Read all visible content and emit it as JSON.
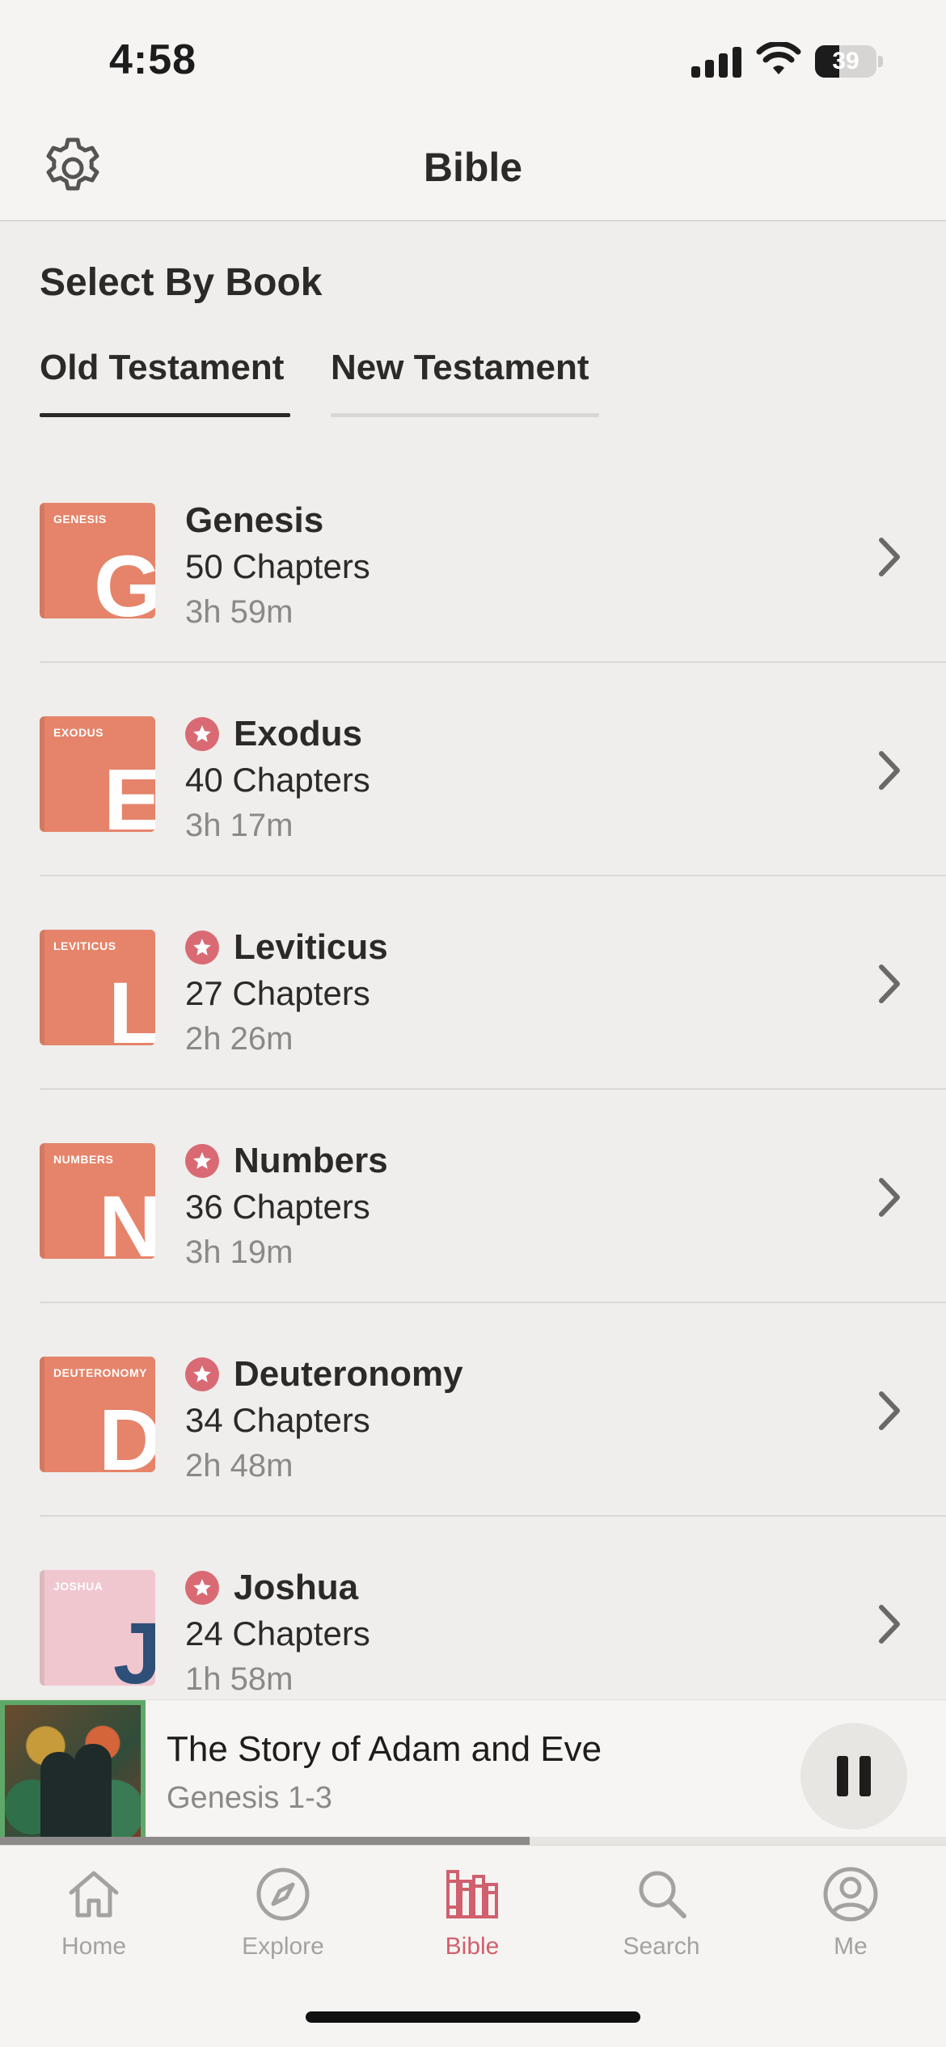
{
  "status_bar": {
    "time": "4:58",
    "battery": "39",
    "battery_level": 0.39
  },
  "header": {
    "title": "Bible",
    "settings_icon": "gear-icon"
  },
  "section": {
    "title": "Select By Book",
    "tabs": [
      {
        "label": "Old Testament",
        "selected": true
      },
      {
        "label": "New Testament",
        "selected": false
      }
    ]
  },
  "books": [
    {
      "cover_title": "GENESIS",
      "letter": "G",
      "name": "Genesis",
      "chapters": "50 Chapters",
      "duration": "3h 59m",
      "starred": false,
      "cover_color": "#e5846a"
    },
    {
      "cover_title": "EXODUS",
      "letter": "E",
      "name": "Exodus",
      "chapters": "40 Chapters",
      "duration": "3h 17m",
      "starred": true,
      "cover_color": "#e5846a"
    },
    {
      "cover_title": "LEVITICUS",
      "letter": "L",
      "name": "Leviticus",
      "chapters": "27 Chapters",
      "duration": "2h 26m",
      "starred": true,
      "cover_color": "#e5846a"
    },
    {
      "cover_title": "NUMBERS",
      "letter": "N",
      "name": "Numbers",
      "chapters": "36 Chapters",
      "duration": "3h 19m",
      "starred": true,
      "cover_color": "#e5846a"
    },
    {
      "cover_title": "DEUTERONOMY",
      "letter": "D",
      "name": "Deuteronomy",
      "chapters": "34 Chapters",
      "duration": "2h 48m",
      "starred": true,
      "cover_color": "#e5846a"
    },
    {
      "cover_title": "JOSHUA",
      "letter": "J",
      "name": "Joshua",
      "chapters": "24 Chapters",
      "duration": "1h 58m",
      "starred": true,
      "cover_color": "#f1c7cf"
    }
  ],
  "player": {
    "title": "The Story of Adam and Eve",
    "subtitle": "Genesis 1-3",
    "progress": 0.56,
    "state": "playing"
  },
  "tab_bar": {
    "items": [
      {
        "label": "Home",
        "icon": "home-icon",
        "active": false
      },
      {
        "label": "Explore",
        "icon": "compass-icon",
        "active": false
      },
      {
        "label": "Bible",
        "icon": "bible-books-icon",
        "active": true
      },
      {
        "label": "Search",
        "icon": "search-icon",
        "active": false
      },
      {
        "label": "Me",
        "icon": "profile-icon",
        "active": false
      }
    ]
  },
  "colors": {
    "accent": "#d0606d",
    "star_badge": "#d96a74",
    "cover_orange": "#e5846a"
  }
}
